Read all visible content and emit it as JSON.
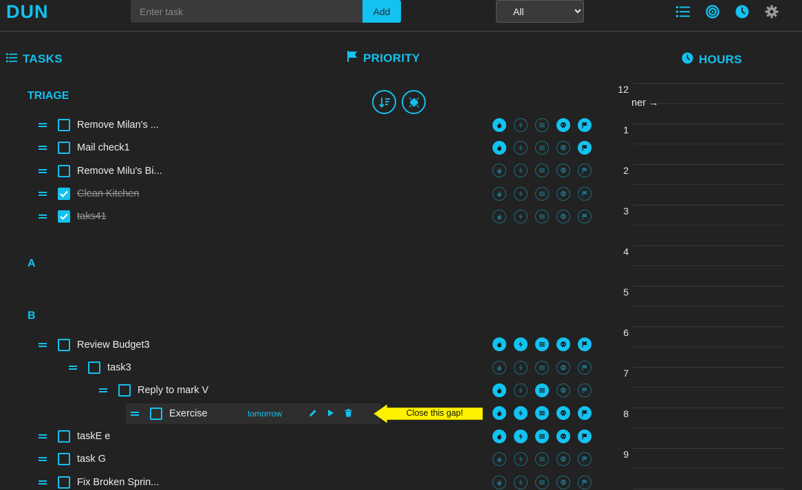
{
  "app": {
    "logo": "DUN"
  },
  "toolbar": {
    "task_placeholder": "Enter task",
    "add_label": "Add",
    "filter_selected": "All",
    "nav_icons": [
      "list-icon",
      "target-icon",
      "clock-icon",
      "gear-icon"
    ]
  },
  "sections": {
    "tasks": "TASKS",
    "priority": "PRIORITY",
    "hours": "HOURS"
  },
  "priority_controls": [
    "sort-icon",
    "collapse-icon"
  ],
  "groups": {
    "triage": "TRIAGE",
    "a": "A",
    "b": "B"
  },
  "tasks": [
    {
      "name": "Remove Milan's ...",
      "done": false,
      "level": 0,
      "priority": [
        true,
        false,
        false,
        true,
        true
      ]
    },
    {
      "name": "Mail check1",
      "done": false,
      "level": 0,
      "priority": [
        true,
        false,
        false,
        false,
        true
      ]
    },
    {
      "name": "Remove Milu's Bi...",
      "done": false,
      "level": 0,
      "priority": [
        false,
        false,
        false,
        false,
        false
      ]
    },
    {
      "name": "Clean Kitchen",
      "done": true,
      "level": 0,
      "priority": [
        false,
        false,
        false,
        false,
        false
      ]
    },
    {
      "name": "taks41",
      "done": true,
      "level": 0,
      "priority": [
        false,
        false,
        false,
        false,
        false
      ]
    },
    {
      "name": "Review Budget3",
      "done": false,
      "level": 0,
      "priority": [
        true,
        true,
        true,
        true,
        true
      ]
    },
    {
      "name": "task3",
      "done": false,
      "level": 1,
      "priority": [
        false,
        false,
        false,
        false,
        false
      ]
    },
    {
      "name": "Reply to mark V",
      "done": false,
      "level": 2,
      "priority": [
        true,
        false,
        true,
        false,
        false
      ]
    },
    {
      "name": "Exercise",
      "done": false,
      "level": 3,
      "due": "tomorrow",
      "priority": [
        true,
        true,
        true,
        true,
        true
      ]
    },
    {
      "name": "taskE e",
      "done": false,
      "level": 0,
      "priority": [
        true,
        true,
        true,
        true,
        true
      ]
    },
    {
      "name": "task G",
      "done": false,
      "level": 0,
      "priority": [
        false,
        false,
        false,
        false,
        false
      ]
    },
    {
      "name": "Fix Broken Sprin...",
      "done": false,
      "level": 0,
      "priority": [
        false,
        false,
        false,
        false,
        false
      ]
    }
  ],
  "priority_icon_names": [
    "fire-icon",
    "bolt-icon",
    "list-icon",
    "skull-icon",
    "flag-icon"
  ],
  "row_action_icons": [
    "pencil-icon",
    "play-icon",
    "trash-icon"
  ],
  "annotation": {
    "text": "Close this gap!"
  },
  "hours": {
    "labels": [
      "12",
      "1",
      "2",
      "3",
      "4",
      "5",
      "6",
      "7",
      "8",
      "9"
    ],
    "event_fragment": "ner →"
  },
  "colors": {
    "accent": "#12c2f0",
    "background": "#222222",
    "callout": "#fff200"
  }
}
